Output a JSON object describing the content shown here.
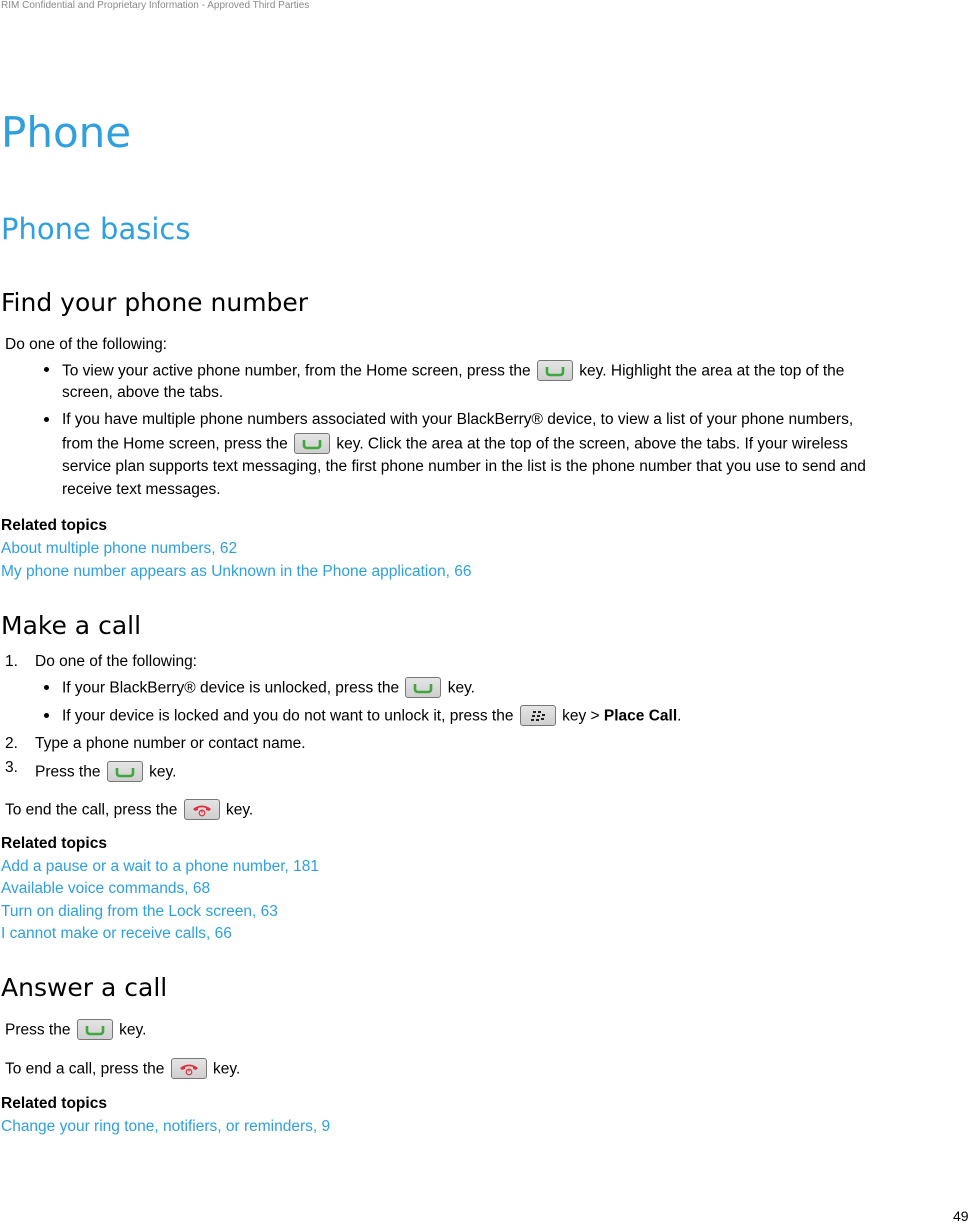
{
  "header": {
    "confidential": "RIM Confidential and Proprietary Information - Approved Third Parties"
  },
  "title": "Phone",
  "subtitle": "Phone basics",
  "keys": {
    "send": "send-key-icon",
    "end": "end-key-icon",
    "menu": "blackberry-menu-key-icon"
  },
  "sections": {
    "find": {
      "heading": "Find your phone number",
      "intro": "Do one of the following:",
      "b1_a": "To view your active phone number, from the Home screen, press the",
      "b1_b": "key. Highlight the area at the top of the",
      "b1_c": "screen, above the tabs.",
      "b2_a": "If you have multiple phone numbers associated with your BlackBerry® device, to view a list of your phone numbers,",
      "b2_b": "from the Home screen, press the",
      "b2_c": "key. Click the area at the top of the screen, above the tabs. If your wireless",
      "b2_d": "service plan supports text messaging, the first phone number in the list is the phone number that you use to send and",
      "b2_e": "receive text messages.",
      "related_label": "Related topics",
      "related": [
        "About multiple phone numbers, 62",
        "My phone number appears as Unknown in the Phone application, 66"
      ]
    },
    "make": {
      "heading": "Make a call",
      "s1_num": "1.",
      "s1": "Do one of the following:",
      "s1b1_a": "If your BlackBerry® device is unlocked, press the",
      "s1b1_b": "key.",
      "s1b2_a": "If your device is locked and you do not want to unlock it, press the",
      "s1b2_b": "key >",
      "s1b2_bold": "Place Call",
      "s1b2_c": ".",
      "s2_num": "2.",
      "s2": "Type a phone number or contact name.",
      "s3_num": "3.",
      "s3_a": "Press the",
      "s3_b": "key.",
      "end_a": "To end the call, press the",
      "end_b": "key.",
      "related_label": "Related topics",
      "related": [
        "Add a pause or a wait to a phone number, 181",
        "Available voice commands, 68",
        "Turn on dialing from the Lock screen, 63",
        "I cannot make or receive calls, 66"
      ]
    },
    "answer": {
      "heading": "Answer a call",
      "press_a": "Press the",
      "press_b": "key.",
      "end_a": "To end a call, press the",
      "end_b": "key.",
      "related_label": "Related topics",
      "related": [
        "Change your ring tone, notifiers, or reminders, 9"
      ]
    }
  },
  "footer": {
    "page_number": "49"
  }
}
